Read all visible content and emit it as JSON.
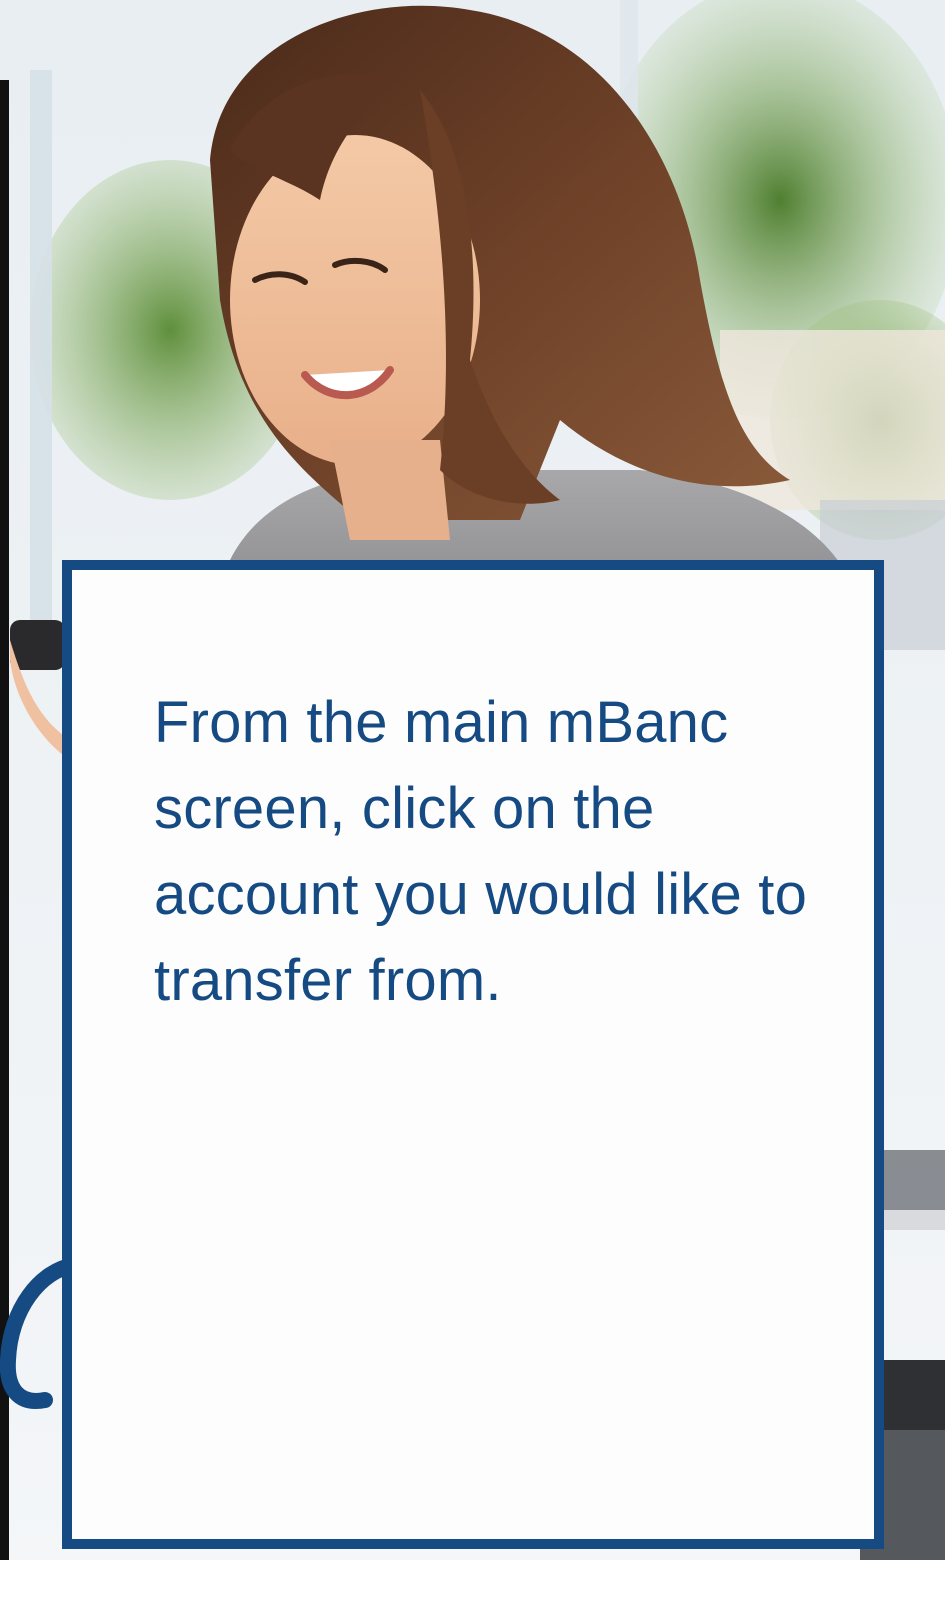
{
  "card": {
    "instruction_text": "From the main mBanc screen, click on the account you would like to transfer from."
  },
  "colors": {
    "brand_blue": "#154a82",
    "card_background": "#fdfdfd"
  },
  "background": {
    "icon": "woman-with-phone-photo"
  }
}
